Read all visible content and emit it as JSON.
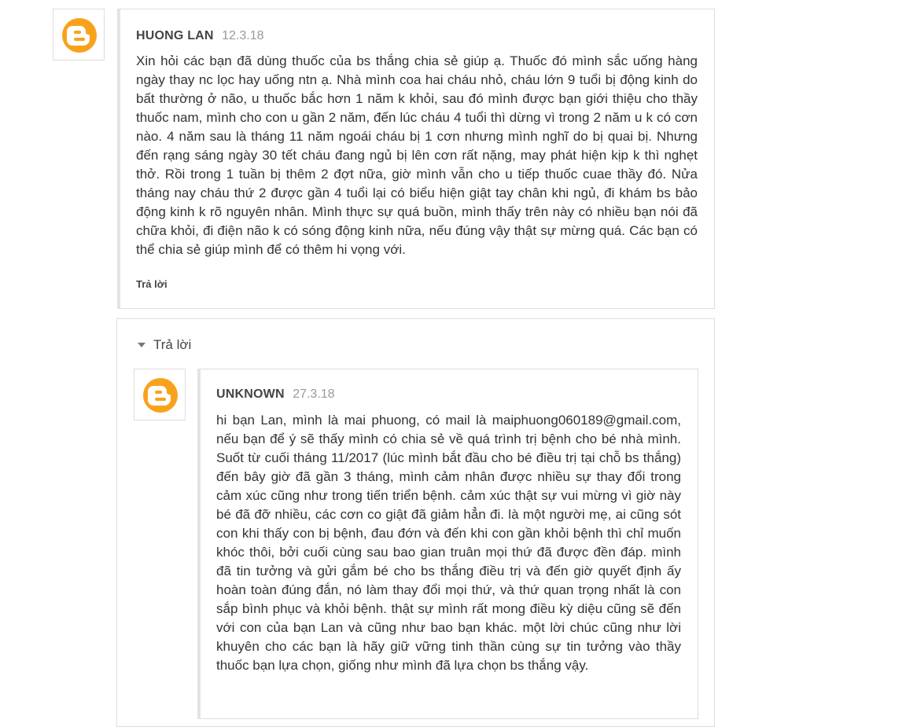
{
  "comments": [
    {
      "author": "HUONG LAN",
      "date": "12.3.18",
      "avatar_icon": "blogger-icon",
      "text": "Xin hỏi các bạn đã dùng thuốc của bs thắng chia sẻ giúp ạ. Thuốc đó mình sắc uống hàng ngày thay nc lọc hay uống ntn ạ. Nhà mình coa hai cháu nhỏ, cháu lớn 9 tuổi bị động kinh do bất thường ở não, u thuốc bắc hơn 1 năm k khỏi, sau đó mình được bạn giới thiệu cho thầy thuốc nam, mình cho con u gần 2 năm, đến lúc cháu 4 tuổi thì dừng vì trong 2 năm u k có cơn nào. 4 năm sau là tháng 11 năm ngoái cháu bị 1 cơn nhưng mình nghĩ do bị quai bị. Nhưng đến rạng sáng ngày 30 tết cháu đang ngủ bị lên cơn rất nặng, may phát hiện kịp k thì nghẹt thở. Rồi trong 1 tuần bị thêm 2 đợt nữa, giờ mình vẫn cho u tiếp thuốc cuae thầy đó. Nửa tháng nay cháu thứ 2 được gần 4 tuổi lại có biểu hiện giật tay chân khi ngủ, đi khám bs bảo động kinh k rõ nguyên nhân. Mình thực sự quá buồn, mình thấy trên này có nhiều bạn nói đã chữa khỏi, đi điện não k có sóng động kinh nữa, nếu đúng vậy thật sự mừng quá. Các bạn có thể chia sẻ giúp mình để có thêm hi vọng với.",
      "reply_label": "Trả lời"
    }
  ],
  "thread_toggle_label": "Trả lời",
  "replies": [
    {
      "author": "UNKNOWN",
      "date": "27.3.18",
      "avatar_icon": "blogger-icon",
      "text": "hi bạn Lan, mình là mai phuong, có mail là maiphuong060189@gmail.com, nếu bạn để ý sẽ thấy mình có chia sẻ về quá trình trị bệnh cho bé nhà mình. Suốt từ cuối tháng 11/2017 (lúc mình bắt đầu cho bé điều trị tại chỗ bs thắng) đến bây giờ đã gần 3 tháng, mình cảm nhân được nhiều sự thay đổi trong cảm xúc cũng như trong tiến triển bệnh. cảm xúc thật sự vui mừng vì giờ này bé đã đỡ nhiều, các cơn co giật đã giảm hẳn đi. là một người mẹ, ai cũng sót con khi thấy con bị bệnh, đau đớn và đến khi con gần khỏi bệnh thì chỉ muốn khóc thôi, bởi cuối cùng sau bao gian truân mọi thứ đã được đền đáp. mình đã tin tưởng và gửi gắm bé cho bs thắng điều trị và đến giờ quyết định ấy hoàn toàn đúng đắn, nó làm thay đổi mọi thứ, và thứ quan trọng nhất là con sắp bình phục và khỏi bệnh. thật sự mình rất mong điều kỳ diệu cũng sẽ đến với con của bạn Lan và cũng như bao bạn khác. một lời chúc cũng như lời khuyên cho các bạn là hãy giữ vững tinh thần cùng sự tin tưởng vào thầy thuốc bạn lựa chọn, giống như mình đã lựa chọn bs thắng vậy."
    }
  ],
  "colors": {
    "blogger_orange": "#f8a21c",
    "border": "#dddddd",
    "author_text": "#444444",
    "date_text": "#999999"
  }
}
